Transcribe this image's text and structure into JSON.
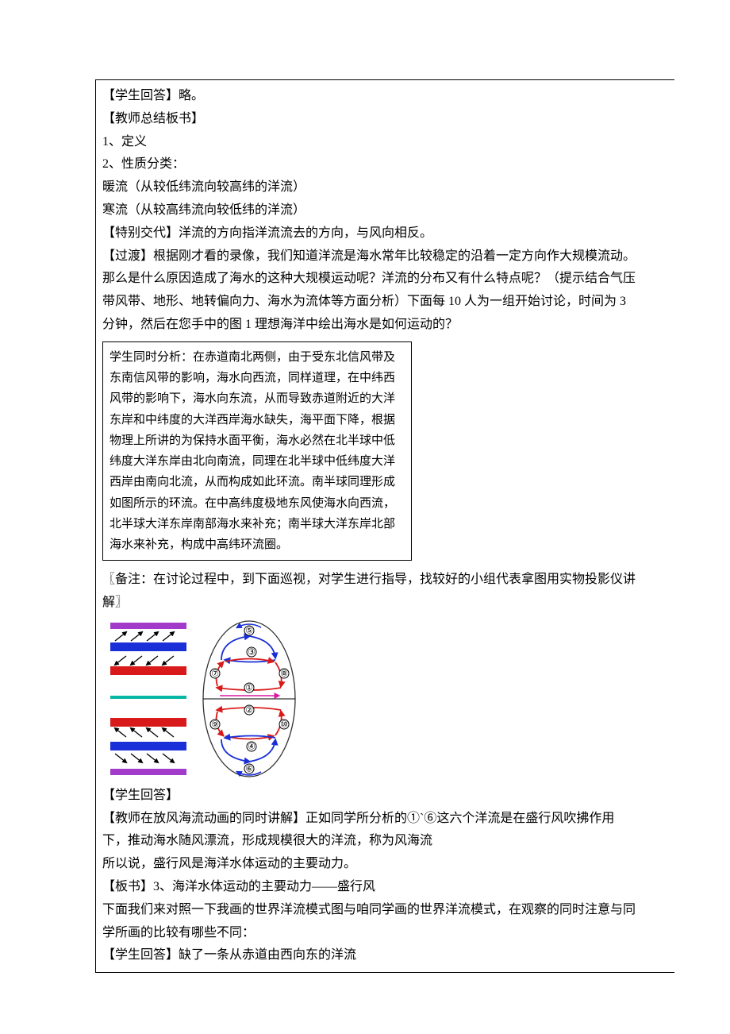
{
  "lines": {
    "l1": "【学生回答】略。",
    "l2": "【教师总结板书】",
    "l3": "1、定义",
    "l4": "2、性质分类：",
    "l5": "暖流（从较低纬流向较高纬的洋流）",
    "l6": "寒流（从较高纬流向较低纬的洋流）",
    "l7": "【特别交代】洋流的方向指洋流流去的方向，与风向相反。",
    "l8": "【过渡】根据刚才看的录像，我们知道洋流是海水常年比较稳定的沿着一定方向作大规模流动。那么是什么原因造成了海水的这种大规模运动呢？洋流的分布又有什么特点呢？（提示结合气压带风带、地形、地转偏向力、海水为流体等方面分析）下面每 10 人为一组开始讨论，时间为 3 分钟，然后在您手中的图 1 理想海洋中绘出海水是如何运动的？",
    "box": "学生同时分析：在赤道南北两侧，由于受东北信风带及东南信风带的影响，海水向西流，同样道理，在中纬西风带的影响下，海水向东流，从而导致赤道附近的大洋东岸和中纬度的大洋西岸海水缺失，海平面下降，根据物理上所讲的为保持水面平衡，海水必然在北半球中低纬度大洋东岸由北向南流，同理在北半球中低纬度大洋西岸由南向北流，从而构成如此环流。南半球同理形成如图所示的环流。在中高纬度极地东风使海水向西流，北半球大洋东岸南部海水来补充；南半球大洋东岸北部海水来补充，构成中高纬环流圈。",
    "l9": "〖备注：在讨论过程中，到下面巡视，对学生进行指导，找较好的小组代表拿图用实物投影仪讲解〗",
    "l10": "【学生回答】",
    "l11": "【教师在放风海流动画的同时讲解】正如同学所分析的①`⑥这六个洋流是在盛行风吹拂作用下，推动海水随风漂流，形成规模很大的洋流，称为风海流",
    "l12": "所以说，盛行风是海洋水体运动的主要动力。",
    "l13": "【板书】3、海洋水体运动的主要动力——盛行风",
    "l14": "下面我们来对照一下我画的世界洋流模式图与咱同学画的世界洋流模式，在观察的同时注意与同学所画的比较有哪些不同：",
    "l15": "【学生回答】缺了一条从赤道由西向东的洋流"
  },
  "diagram": {
    "labels": {
      "n1": "①",
      "n2": "②",
      "n3": "③",
      "n4": "④",
      "n5": "⑤",
      "n6": "⑥",
      "n7": "⑦",
      "n8": "⑧",
      "n9": "⑨",
      "n10": "⑩"
    },
    "colors": {
      "polar": "#a23bc9",
      "westerlies": "#1a2fd8",
      "trades": "#d81a1a",
      "equator": "#08b7a3",
      "ellipse": "#333333",
      "axis": "#000000",
      "gyreN": "#d81a1a",
      "gyreSub": "#1a2fd8"
    }
  }
}
